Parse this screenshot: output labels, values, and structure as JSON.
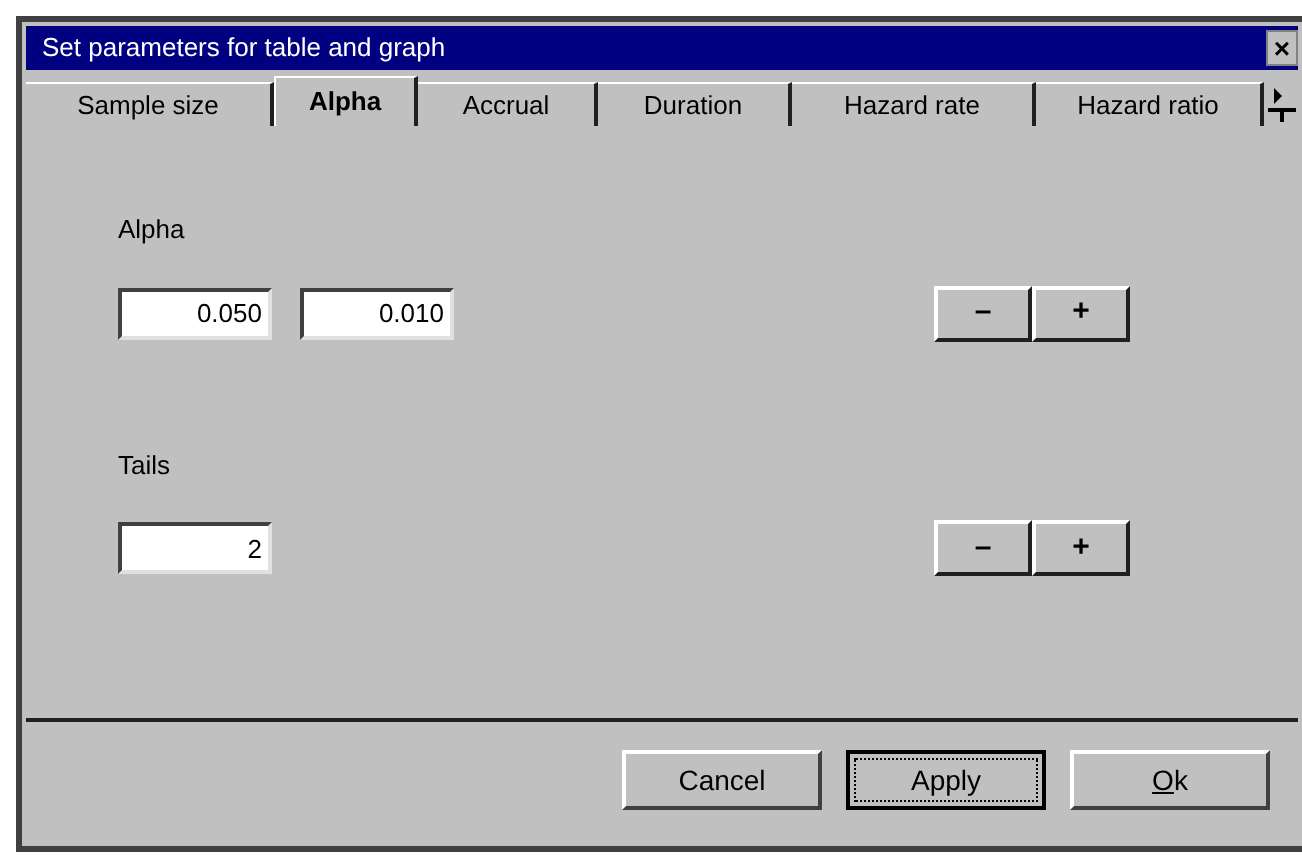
{
  "window": {
    "title": "Set parameters for table and graph",
    "close": "×"
  },
  "tabs": [
    {
      "label": "Sample size",
      "selected": false
    },
    {
      "label": "Alpha",
      "selected": true
    },
    {
      "label": "Accrual",
      "selected": false
    },
    {
      "label": "Duration",
      "selected": false
    },
    {
      "label": "Hazard rate",
      "selected": false
    },
    {
      "label": "Hazard ratio",
      "selected": false
    }
  ],
  "groups": [
    {
      "label": "Alpha",
      "values": [
        "0.050",
        "0.010"
      ],
      "buttons": [
        "–",
        "+"
      ]
    },
    {
      "label": "Tails",
      "values": [
        "2"
      ],
      "buttons": [
        "–",
        "+"
      ]
    }
  ],
  "buttons": [
    {
      "label": "Cancel",
      "focused": false,
      "underline_first": false
    },
    {
      "label": "Apply",
      "focused": true,
      "underline_first": false
    },
    {
      "label": "Ok",
      "focused": false,
      "underline_first": true
    }
  ]
}
